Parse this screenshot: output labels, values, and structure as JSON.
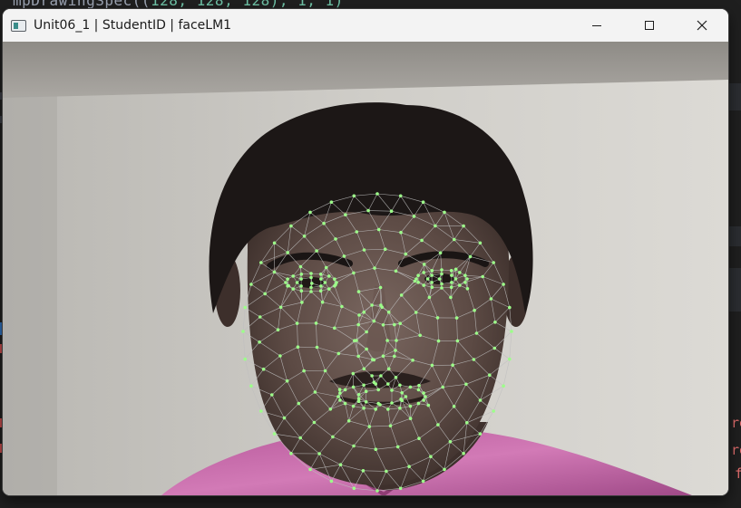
{
  "editor": {
    "top_code_prefix": "mpDrawingSpec((",
    "top_code_numbers": "128, 128, 128), 1, 1)",
    "right_fragments": [
      "re",
      "re",
      "f"
    ]
  },
  "window": {
    "title": "Unit06_1 | StudentID | faceLM1",
    "controls": {
      "minimize_icon": "minimize-icon",
      "maximize_icon": "maximize-icon",
      "close_icon": "close-icon"
    }
  },
  "frame": {
    "content": "webcam frame with face mesh landmarks",
    "landmark_color": "#9dff8a",
    "mesh_line_color": "#bfbfbf"
  }
}
